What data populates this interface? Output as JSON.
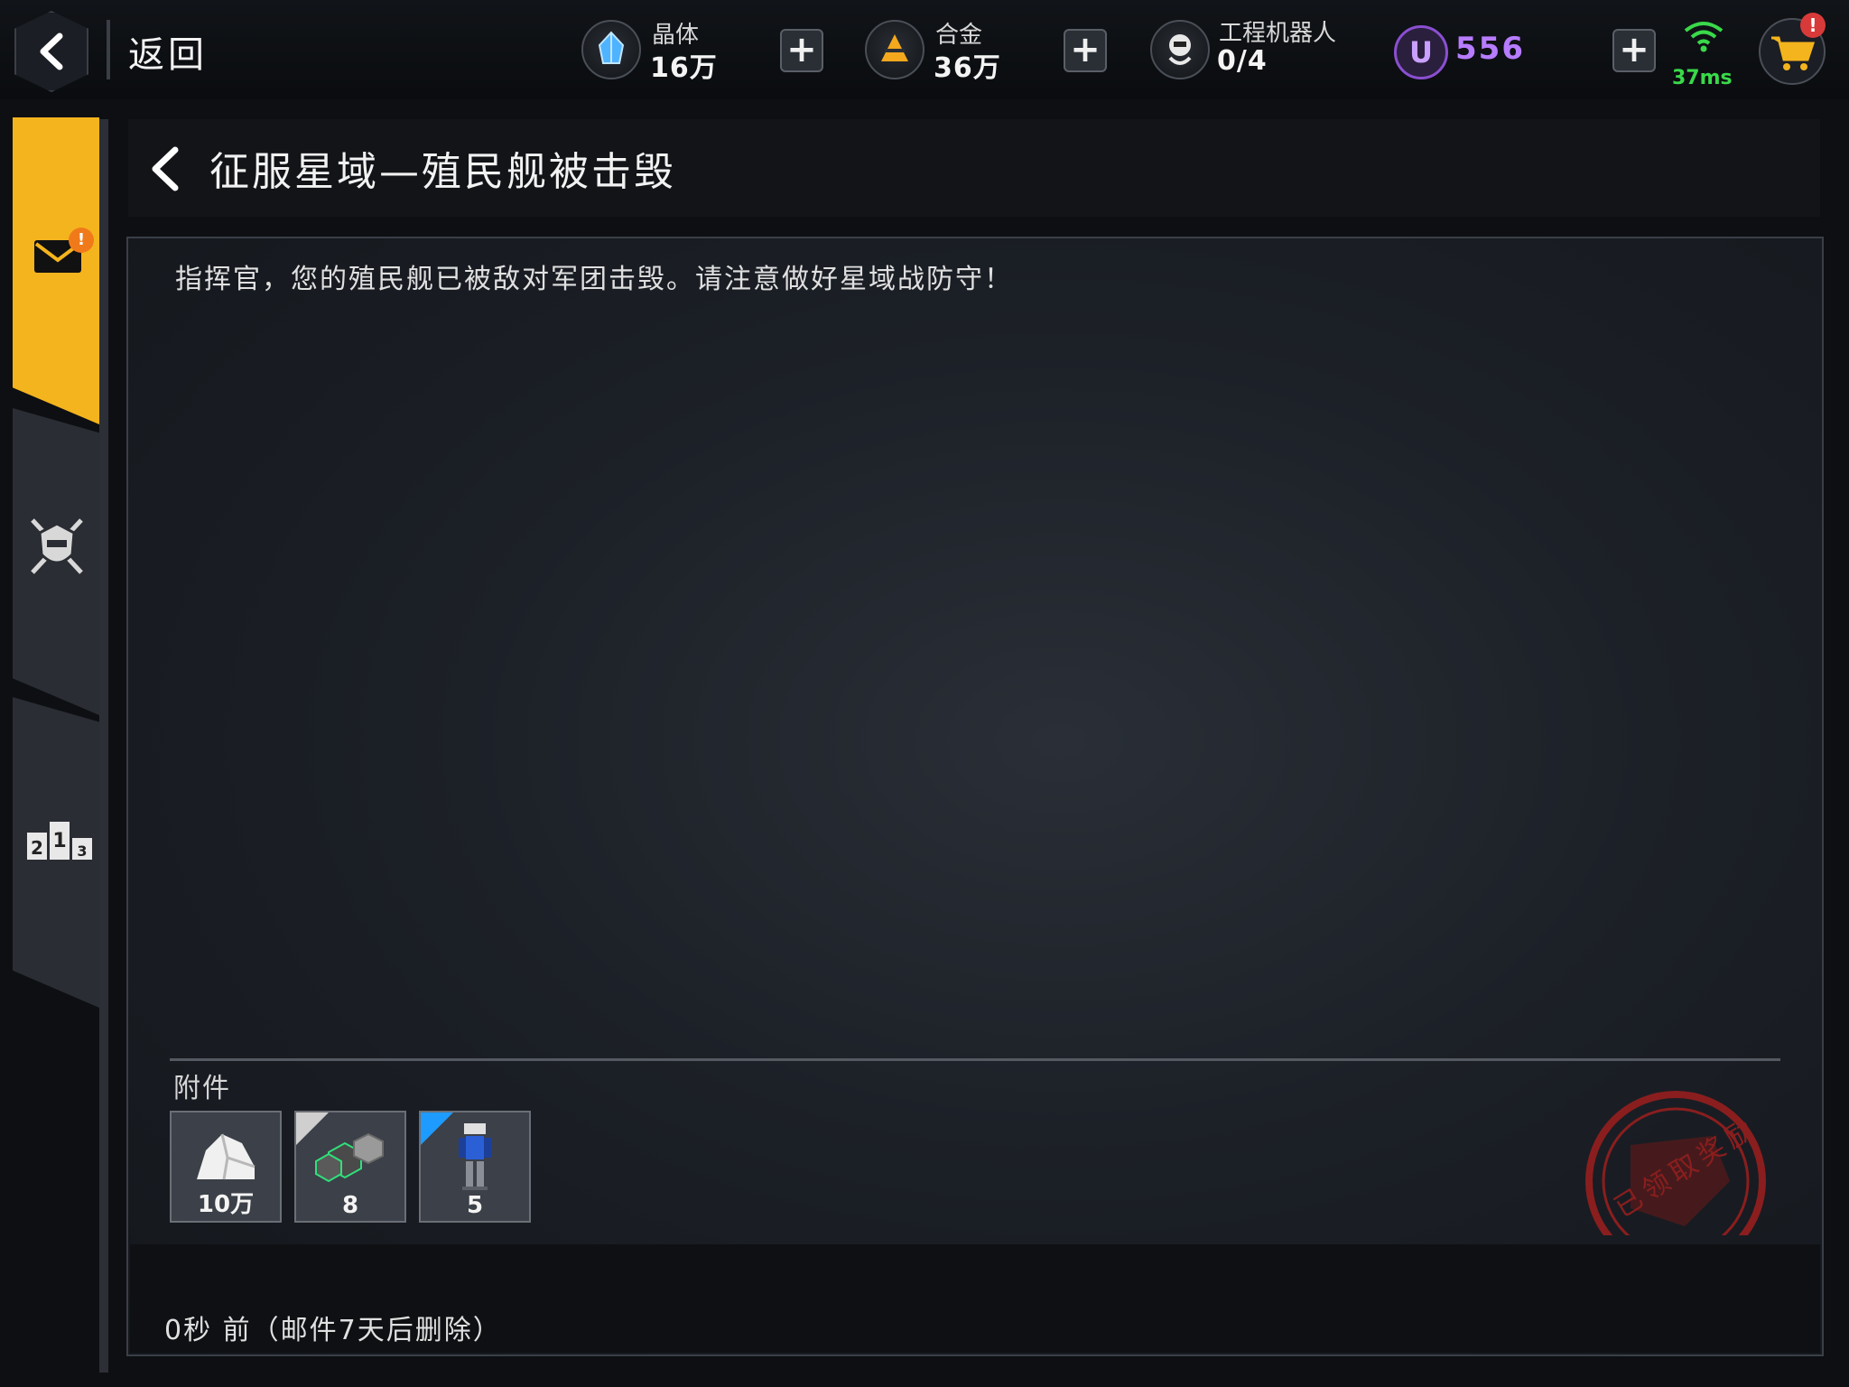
{
  "topbar": {
    "back_label": "返回",
    "resources": [
      {
        "name": "晶体",
        "value": "16万",
        "icon": "crystal-icon",
        "color": "#4fb3ff"
      },
      {
        "name": "合金",
        "value": "36万",
        "icon": "alloy-icon",
        "color": "#f4a81d"
      },
      {
        "name": "工程机器人",
        "value": "0/4",
        "icon": "robot-icon"
      }
    ],
    "premium": {
      "symbol": "U",
      "value": "556",
      "color": "#b77cff"
    },
    "plus_symbol": "+",
    "ping": "37ms",
    "cart_badge": "!"
  },
  "sidebar": {
    "tabs": [
      {
        "name": "mail",
        "icon": "mail-icon",
        "active": true,
        "badge": "!"
      },
      {
        "name": "guild",
        "icon": "guild-shield-icon",
        "active": false
      },
      {
        "name": "ranking",
        "icon": "podium-icon",
        "active": false
      }
    ],
    "podium_digits": [
      "2",
      "1",
      "3"
    ]
  },
  "mail": {
    "title": "征服星域—殖民舰被击毁",
    "body": "指挥官，您的殖民舰已被敌对军团击毁。请注意做好星域战防守！",
    "attachments_label": "附件",
    "attachments": [
      {
        "icon": "ore-icon",
        "count": "10万",
        "rarity_color": ""
      },
      {
        "icon": "hex-plates-icon",
        "count": "8",
        "rarity_color": "#cfcfcf"
      },
      {
        "icon": "mech-unit-icon",
        "count": "5",
        "rarity_color": "#1e9bff"
      }
    ],
    "timestamp": "0秒 前（邮件7天后删除）",
    "stamp_text": "已领取奖励"
  }
}
